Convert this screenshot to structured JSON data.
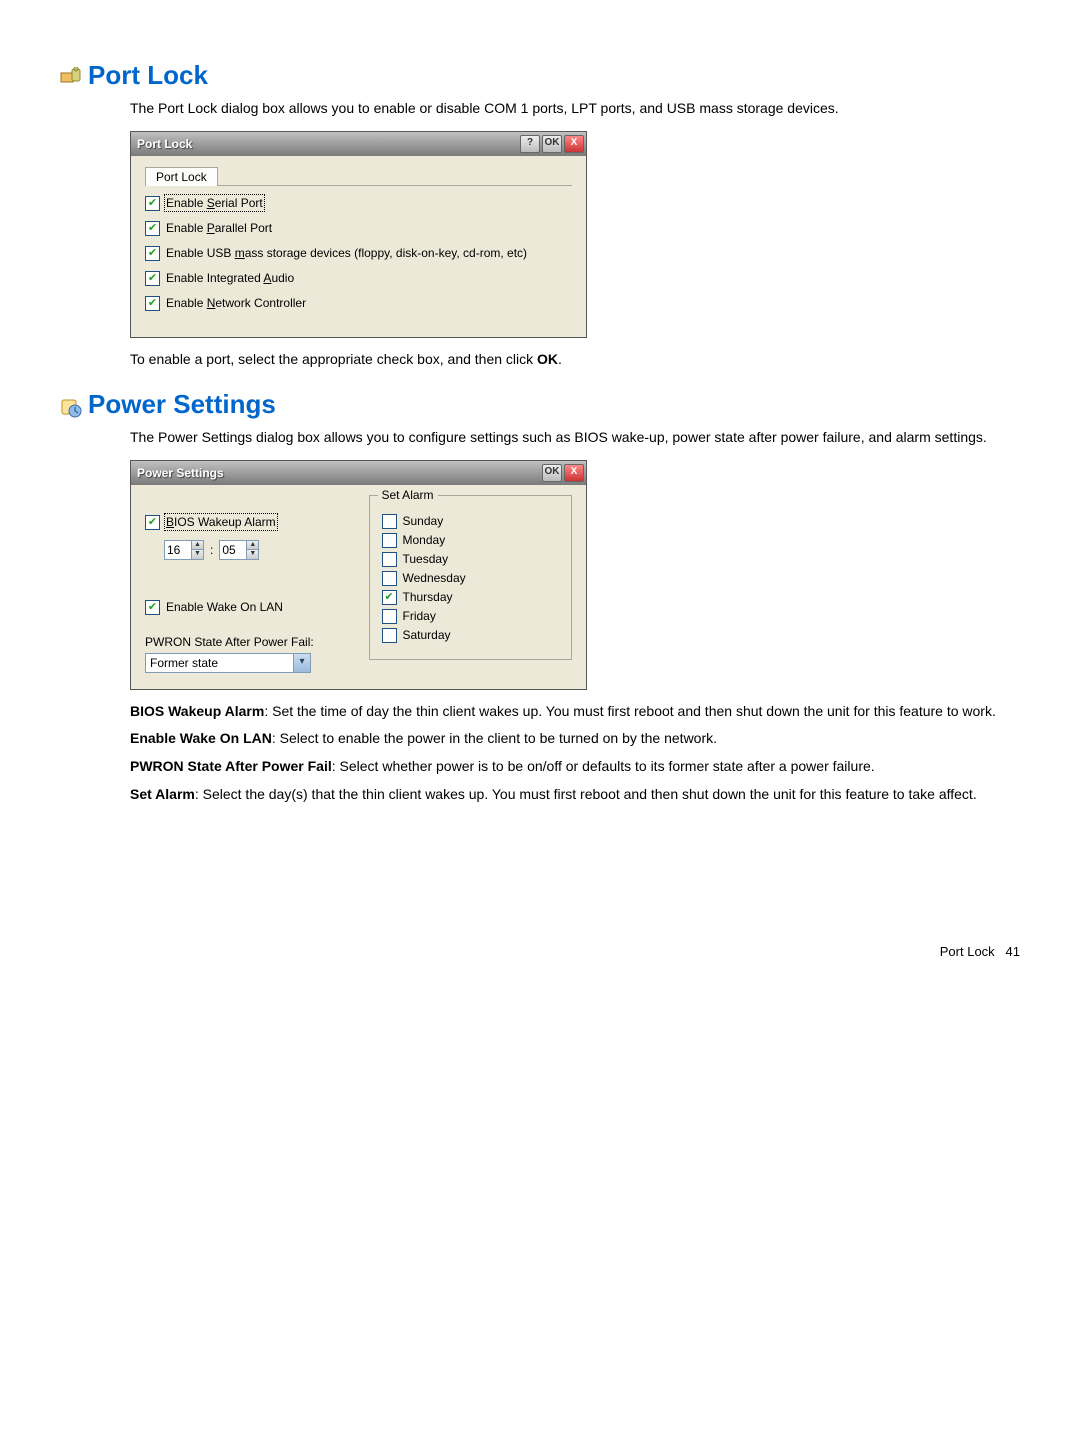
{
  "sections": {
    "portlock": {
      "heading": "Port Lock",
      "intro": "The Port Lock dialog box allows you to enable or disable COM 1 ports, LPT ports, and USB mass storage devices.",
      "outro_pre": "To enable a port, select the appropriate check box, and then click ",
      "outro_bold": "OK",
      "outro_post": "."
    },
    "power": {
      "heading": "Power Settings",
      "intro": "The Power Settings dialog box allows you to configure settings such as BIOS wake-up, power state after power failure, and alarm settings."
    }
  },
  "portlock_dialog": {
    "title": "Port Lock",
    "tab": "Port Lock",
    "checks": [
      {
        "label_pre": "Enable ",
        "accel": "S",
        "label_post": "erial Port",
        "checked": true,
        "focused": true
      },
      {
        "label_pre": "Enable ",
        "accel": "P",
        "label_post": "arallel Port",
        "checked": true,
        "focused": false
      },
      {
        "label_pre": "Enable USB ",
        "accel": "m",
        "label_post": "ass storage devices (floppy, disk-on-key, cd-rom, etc)",
        "checked": true,
        "focused": false
      },
      {
        "label_pre": "Enable Integrated ",
        "accel": "A",
        "label_post": "udio",
        "checked": true,
        "focused": false
      },
      {
        "label_pre": "Enable ",
        "accel": "N",
        "label_post": "etwork Controller",
        "checked": true,
        "focused": false
      }
    ],
    "titlebar_buttons": {
      "help": "?",
      "ok": "OK",
      "close": "X"
    }
  },
  "power_dialog": {
    "title": "Power Settings",
    "bios_wakeup": {
      "label_pre": "",
      "accel": "B",
      "label_post": "IOS Wakeup Alarm",
      "checked": true,
      "focused": true
    },
    "time": {
      "hh": "16",
      "mm": "05"
    },
    "wake_on_lan": {
      "label": "Enable Wake On LAN",
      "checked": true
    },
    "pwron_label": "PWRON State After Power Fail:",
    "pwron_value": "Former state",
    "set_alarm_label": "Set Alarm",
    "days": [
      {
        "label": "Sunday",
        "checked": false
      },
      {
        "label": "Monday",
        "checked": false
      },
      {
        "label": "Tuesday",
        "checked": false
      },
      {
        "label": "Wednesday",
        "checked": false
      },
      {
        "label": "Thursday",
        "checked": true
      },
      {
        "label": "Friday",
        "checked": false
      },
      {
        "label": "Saturday",
        "checked": false
      }
    ],
    "titlebar_buttons": {
      "ok": "OK",
      "close": "X"
    }
  },
  "descriptions": {
    "bios": {
      "term": "BIOS Wakeup Alarm",
      "text": ": Set the time of day the thin client wakes up. You must first reboot and then shut down the unit for this feature to work."
    },
    "wol": {
      "term": "Enable Wake On LAN",
      "text": ": Select to enable the power in the client to be turned on by the network."
    },
    "pwron": {
      "term": "PWRON State After Power Fail",
      "text": ": Select whether power is to be on/off or defaults to its former state after a power failure."
    },
    "setalarm": {
      "term": "Set Alarm",
      "text": ": Select the day(s) that the thin client wakes up. You must first reboot and then shut down the unit for this feature to take affect."
    }
  },
  "footer": {
    "section": "Port Lock",
    "page": "41"
  }
}
